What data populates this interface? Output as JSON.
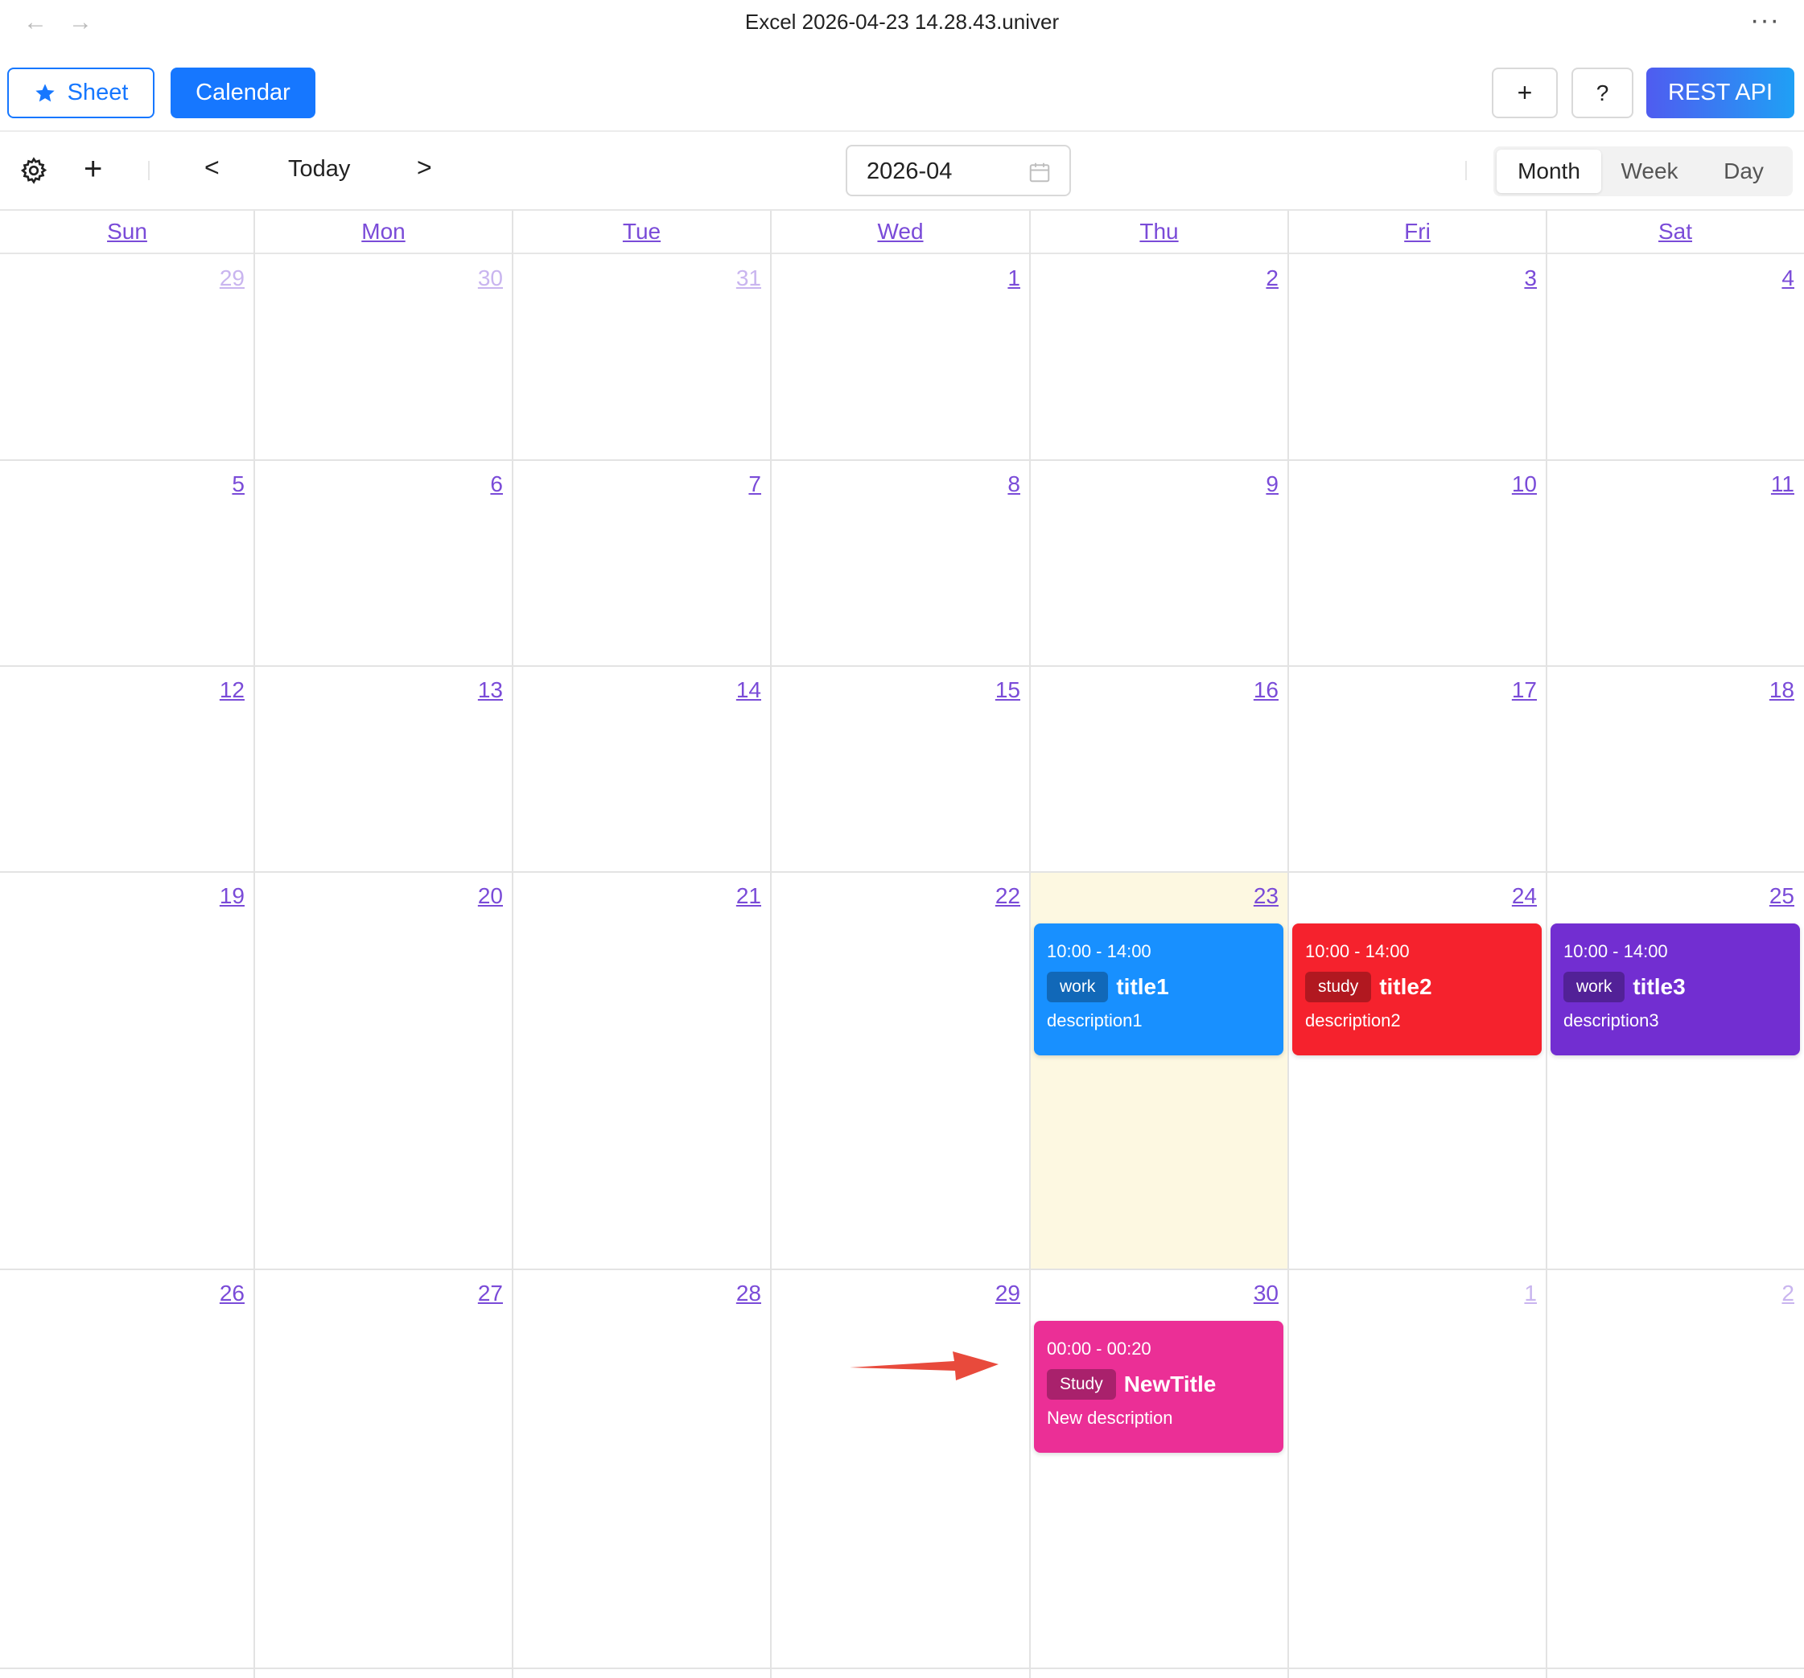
{
  "window": {
    "title": "Excel 2026-04-23 14.28.43.univer",
    "back_icon": "←",
    "forward_icon": "→",
    "more_icon": "···"
  },
  "app_toolbar": {
    "sheet_label": "Sheet",
    "calendar_label": "Calendar",
    "plus_label": "+",
    "help_label": "?",
    "rest_api_label": "REST API"
  },
  "calendar_toolbar": {
    "add_label": "+",
    "prev_label": "<",
    "today_label": "Today",
    "next_label": ">",
    "date_value": "2026-04",
    "views": [
      "Month",
      "Week",
      "Day"
    ],
    "active_view": "Month"
  },
  "weekdays": [
    "Sun",
    "Mon",
    "Tue",
    "Wed",
    "Thu",
    "Fri",
    "Sat"
  ],
  "weeks": [
    [
      {
        "d": "29",
        "other": true
      },
      {
        "d": "30",
        "other": true
      },
      {
        "d": "31",
        "other": true
      },
      {
        "d": "1"
      },
      {
        "d": "2"
      },
      {
        "d": "3"
      },
      {
        "d": "4"
      }
    ],
    [
      {
        "d": "5"
      },
      {
        "d": "6"
      },
      {
        "d": "7"
      },
      {
        "d": "8"
      },
      {
        "d": "9"
      },
      {
        "d": "10"
      },
      {
        "d": "11"
      }
    ],
    [
      {
        "d": "12"
      },
      {
        "d": "13"
      },
      {
        "d": "14"
      },
      {
        "d": "15"
      },
      {
        "d": "16"
      },
      {
        "d": "17"
      },
      {
        "d": "18"
      }
    ],
    [
      {
        "d": "19"
      },
      {
        "d": "20"
      },
      {
        "d": "21"
      },
      {
        "d": "22"
      },
      {
        "d": "23",
        "today": true
      },
      {
        "d": "24"
      },
      {
        "d": "25"
      }
    ],
    [
      {
        "d": "26"
      },
      {
        "d": "27"
      },
      {
        "d": "28"
      },
      {
        "d": "29"
      },
      {
        "d": "30"
      },
      {
        "d": "1",
        "other": true
      },
      {
        "d": "2",
        "other": true
      }
    ]
  ],
  "events": [
    {
      "week": 3,
      "day": 4,
      "time": "10:00 - 14:00",
      "tag": "work",
      "title": "title1",
      "description": "description1",
      "color": "#1890ff"
    },
    {
      "week": 3,
      "day": 5,
      "time": "10:00 - 14:00",
      "tag": "study",
      "title": "title2",
      "description": "description2",
      "color": "#f5222d"
    },
    {
      "week": 3,
      "day": 6,
      "time": "10:00 - 14:00",
      "tag": "work",
      "title": "title3",
      "description": "description3",
      "color": "#722ed1"
    },
    {
      "week": 4,
      "day": 4,
      "time": "00:00 - 00:20",
      "tag": "Study",
      "title": "NewTitle",
      "description": "New description",
      "color": "#eb2f96"
    }
  ],
  "colors": {
    "primary": "#1677ff",
    "day_link": "#7a4bd8",
    "today_bg": "#fdf8e1",
    "annotation_arrow": "#e84a3c"
  }
}
